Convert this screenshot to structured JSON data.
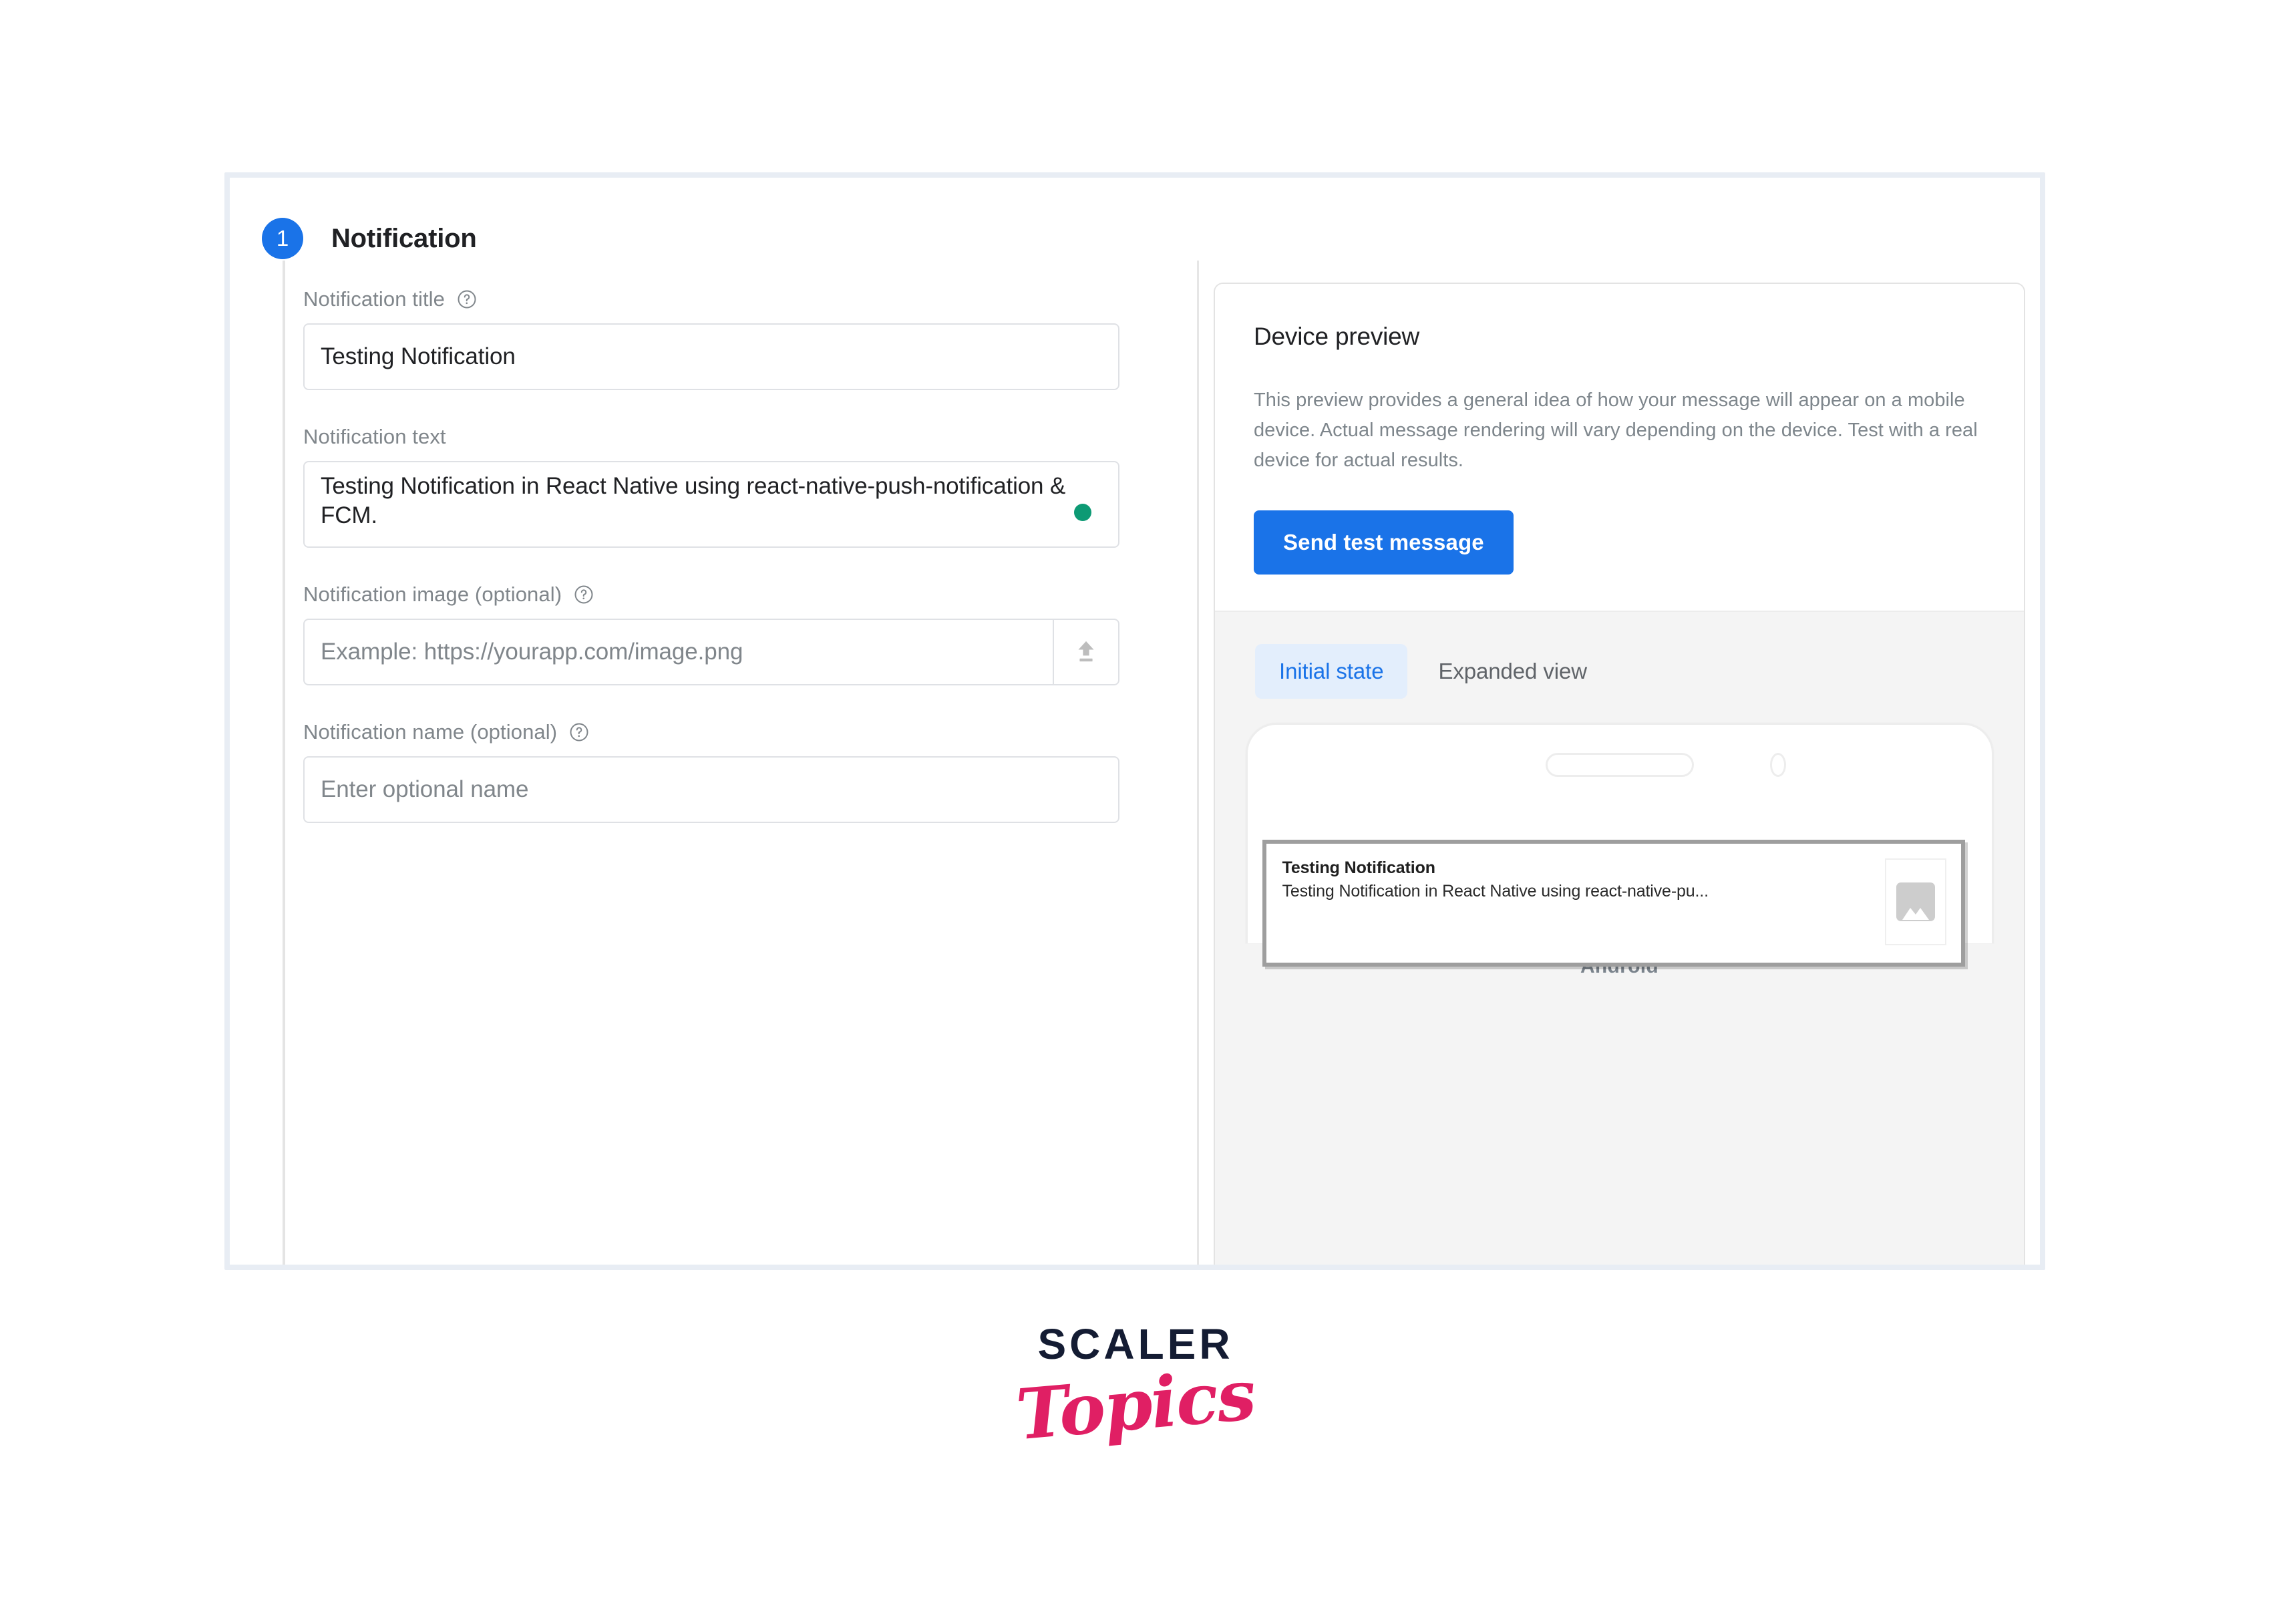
{
  "step": {
    "number": "1",
    "title": "Notification"
  },
  "form": {
    "title_field": {
      "label": "Notification title",
      "help_icon": "help-circle-icon",
      "value": "Testing Notification"
    },
    "text_field": {
      "label": "Notification text",
      "value": "Testing Notification in React Native using react-native-push-notification & FCM.",
      "status_dot_color": "#0d9a74"
    },
    "image_field": {
      "label": "Notification image (optional)",
      "help_icon": "help-circle-icon",
      "placeholder": "Example: https://yourapp.com/image.png",
      "value": "",
      "upload_icon": "upload-icon"
    },
    "name_field": {
      "label": "Notification name (optional)",
      "help_icon": "help-circle-icon",
      "placeholder": "Enter optional name",
      "value": ""
    }
  },
  "preview": {
    "heading": "Device preview",
    "description": "This preview provides a general idea of how your message will appear on a mobile device. Actual message rendering will vary depending on the device. Test with a real device for actual results.",
    "send_test_label": "Send test message",
    "tabs": [
      {
        "label": "Initial state",
        "active": true
      },
      {
        "label": "Expanded view",
        "active": false
      }
    ],
    "notification": {
      "title": "Testing Notification",
      "body": "Testing Notification in React Native using react-native-pu...",
      "thumbnail_icon": "image-placeholder-icon"
    },
    "platform_label": "Android"
  },
  "branding": {
    "primary": "SCALER",
    "secondary": "Topics",
    "accent_color": "#e01f64",
    "brand_color": "#141c33"
  },
  "colors": {
    "accent_blue": "#1a73e8",
    "tab_active_bg": "#e3eefc",
    "card_border": "#e8edf4"
  }
}
